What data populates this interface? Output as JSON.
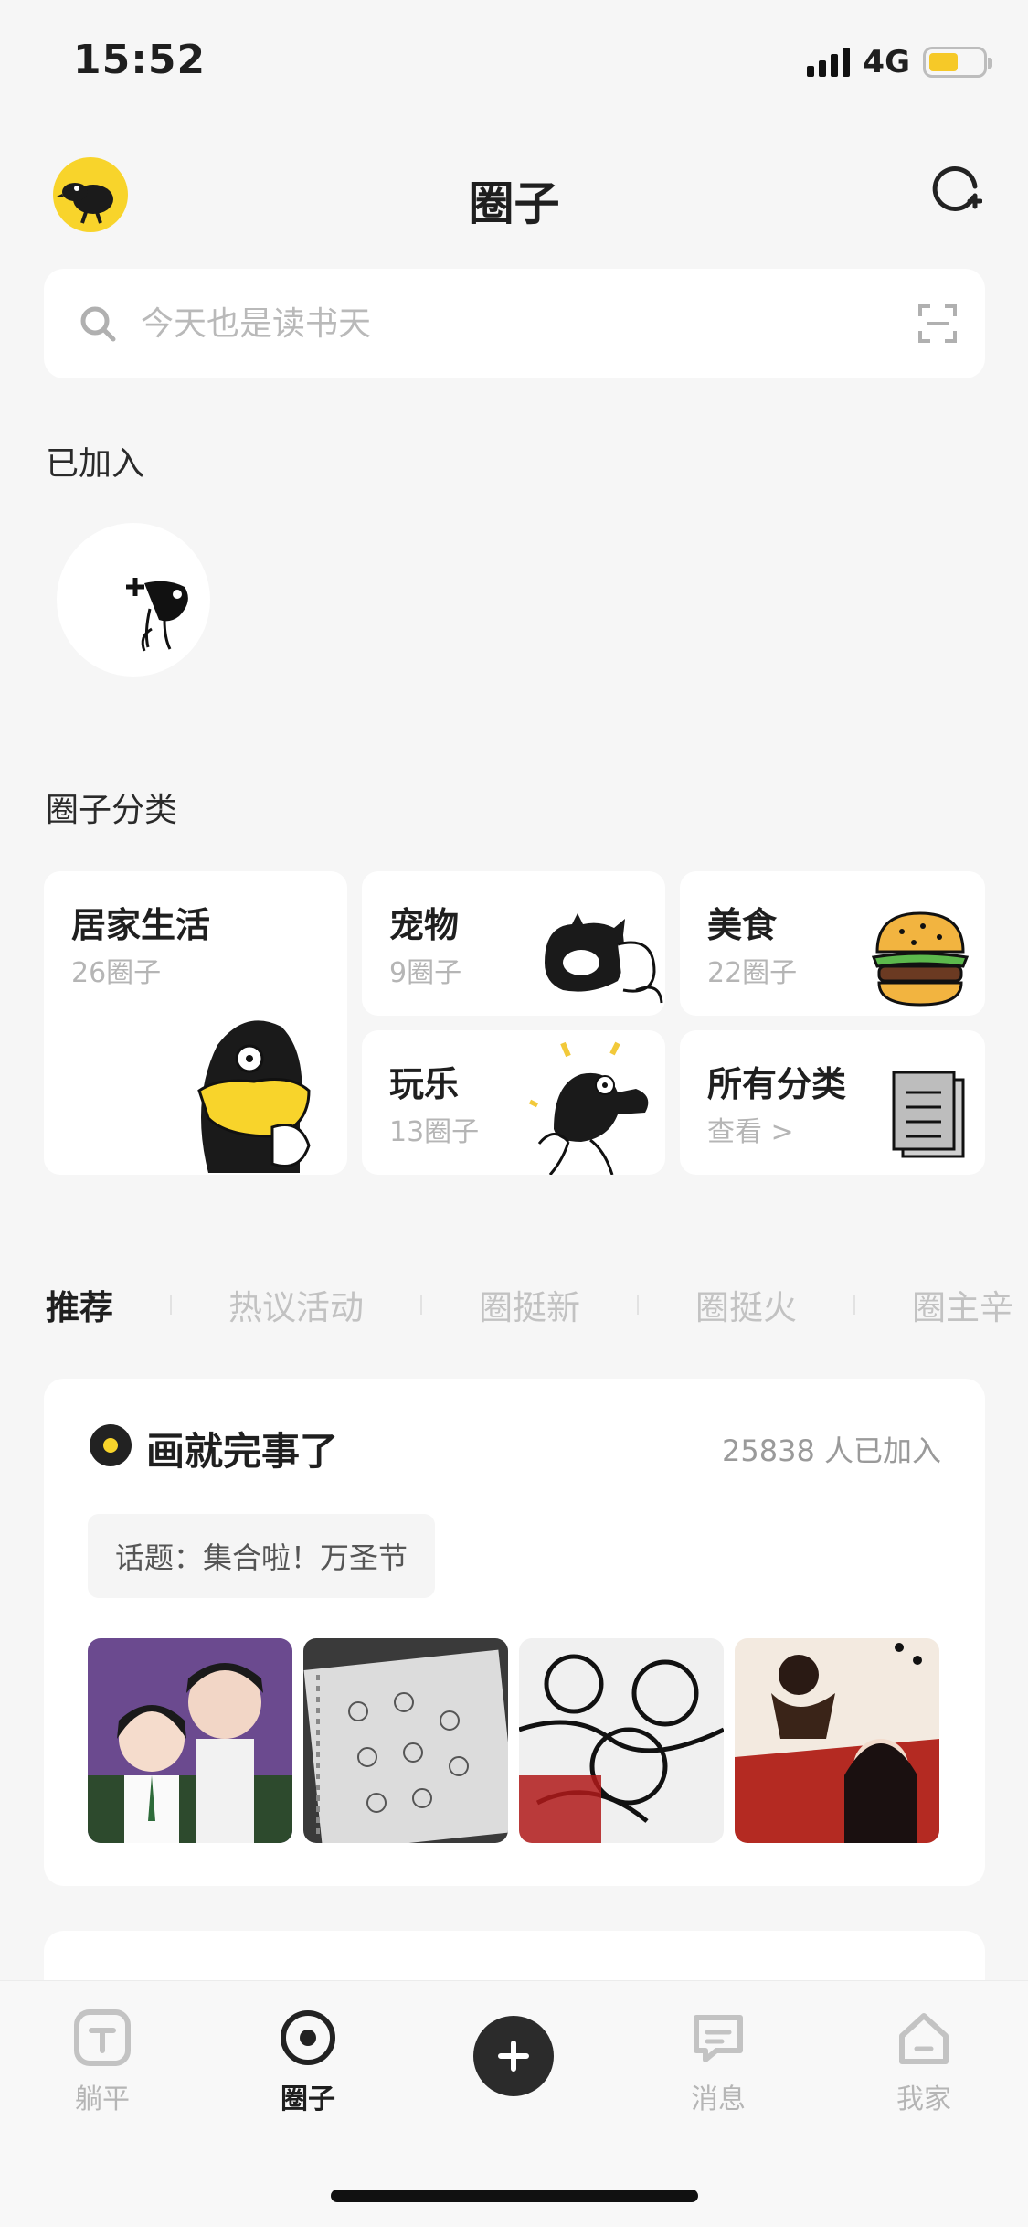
{
  "status_bar": {
    "time": "15:52",
    "network": "4G",
    "battery_level": 0.55
  },
  "header": {
    "title": "圈子",
    "avatar_icon": "bird-avatar-icon",
    "action_icon": "add-circle-icon"
  },
  "search": {
    "placeholder": "今天也是读书天",
    "scan_icon": "scan-icon"
  },
  "joined": {
    "title": "已加入",
    "items": [
      {
        "icon": "add-circle-mascot-icon"
      }
    ]
  },
  "categories": {
    "title": "圈子分类",
    "items": [
      {
        "title": "居家生活",
        "sub": "26圈子"
      },
      {
        "title": "宠物",
        "sub": "9圈子"
      },
      {
        "title": "美食",
        "sub": "22圈子"
      },
      {
        "title": "玩乐",
        "sub": "13圈子"
      },
      {
        "title": "所有分类",
        "sub": "查看 >"
      }
    ]
  },
  "tabs": [
    "推荐",
    "热议活动",
    "圈挺新",
    "圈挺火",
    "圈主辛"
  ],
  "active_tab": 0,
  "featured_circle": {
    "name": "画就完事了",
    "members": "25838 人已加入",
    "topic": "话题：集合啦！万圣节",
    "thumb_count": 4
  },
  "bottom_nav": {
    "items": [
      {
        "label": "躺平",
        "icon": "lie-flat-icon"
      },
      {
        "label": "圈子",
        "icon": "circle-target-icon"
      },
      {
        "label": "消息",
        "icon": "message-icon"
      },
      {
        "label": "我家",
        "icon": "home-icon"
      }
    ],
    "active": 1,
    "plus_icon": "plus-icon"
  },
  "colors": {
    "accent_yellow": "#f8d42b",
    "dark": "#2b2b2b",
    "background": "#f6f6f6"
  }
}
